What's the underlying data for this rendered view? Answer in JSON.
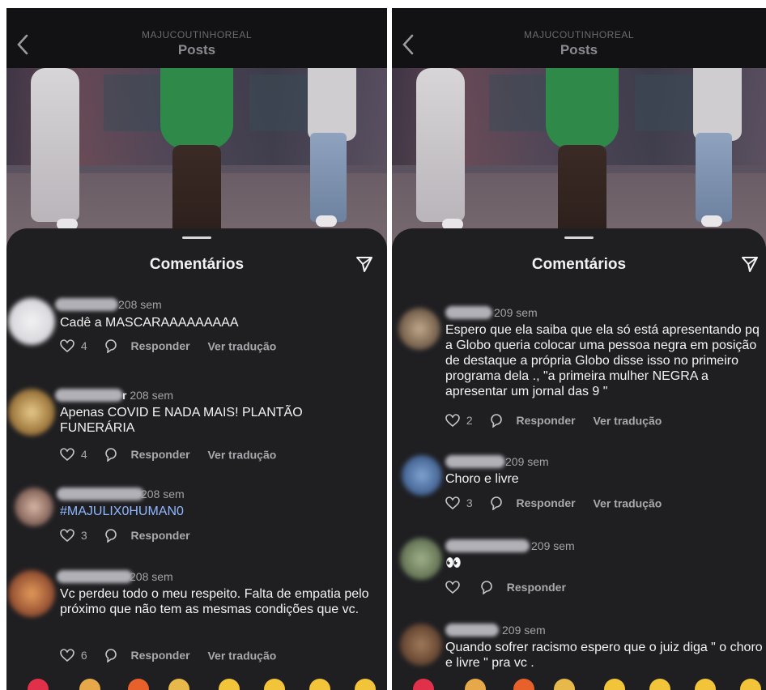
{
  "header": {
    "username": "MAJUCOUTINHOREAL",
    "title": "Posts"
  },
  "sheet": {
    "title": "Comentários"
  },
  "labels": {
    "reply": "Responder",
    "translate": "Ver tradução"
  },
  "icons": {
    "back": "chevron-left-icon",
    "share": "paper-plane-icon",
    "like": "heart-icon",
    "reply": "reply-bubble-icon"
  },
  "colors": {
    "background": "#1f1f22",
    "header": "#121214",
    "hashtag": "#8fb8ff",
    "muted": "#a3a3a8"
  },
  "left_comments": [
    {
      "name_suffix": "",
      "time": "208 sem",
      "text": "Cadê a MASCARAAAAAAAAA",
      "likes": "4",
      "translate": true
    },
    {
      "name_suffix": "r",
      "time": "208 sem",
      "text": "Apenas COVID E NADA MAIS! PLANTÃO FUNERÁRIA",
      "likes": "4",
      "translate": true
    },
    {
      "name_suffix": "",
      "time": "208 sem",
      "text": "#MAJULIX0HUMAN0",
      "likes": "3",
      "translate": false
    },
    {
      "name_suffix": "",
      "time": "208 sem",
      "text": "Vc perdeu todo o meu respeito. Falta de empatia pelo próximo que não tem as mesmas condições que vc.",
      "likes": "6",
      "translate": true
    }
  ],
  "right_comments": [
    {
      "time": "209 sem",
      "text": "Espero que ela saiba que ela só está apresentando pq a Globo queria colocar uma pessoa negra em posição de destaque a própria Globo disse isso no primeiro programa dela ., \"a primeira mulher NEGRA a apresentar um jornal das 9 \"",
      "likes": "2",
      "translate": true
    },
    {
      "time": "209 sem",
      "text": "Choro e livre",
      "likes": "3",
      "translate": true
    },
    {
      "time": "209 sem",
      "text": "👀",
      "likes": "",
      "translate": false
    },
    {
      "time": "209 sem",
      "text": "Quando sofrer racismo espero que o juiz diga \" o choro e livre \" pra vc .",
      "likes": "",
      "translate": false
    }
  ]
}
